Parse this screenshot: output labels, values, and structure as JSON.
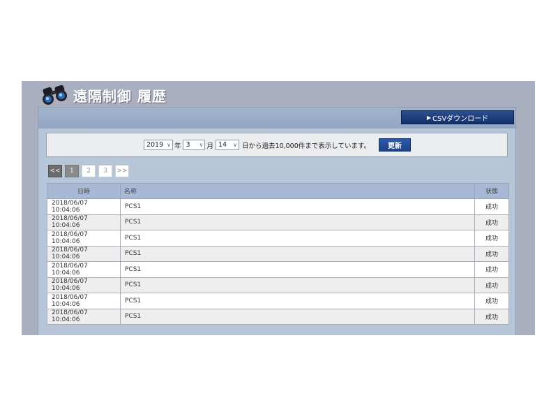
{
  "header": {
    "title": "遠隔制御 履歴"
  },
  "toolbar": {
    "csv_label": "CSVダウンロード"
  },
  "filter": {
    "year": "2019",
    "year_unit": "年",
    "month": "3",
    "month_unit": "月",
    "day": "14",
    "description": "日から過去10,000件まで表示しています。",
    "update_label": "更新"
  },
  "pagination": {
    "prev": "<<",
    "pages": [
      "1",
      "2",
      "3"
    ],
    "next": ">>",
    "current": "1"
  },
  "table": {
    "headers": {
      "date": "日時",
      "name": "名称",
      "status": "状態"
    },
    "rows": [
      {
        "date": "2018/06/07 10:04:06",
        "name": "PCS1",
        "status": "成功"
      },
      {
        "date": "2018/06/07 10:04:06",
        "name": "PCS1",
        "status": "成功"
      },
      {
        "date": "2018/06/07 10:04:06",
        "name": "PCS1",
        "status": "成功"
      },
      {
        "date": "2018/06/07 10:04:06",
        "name": "PCS1",
        "status": "成功"
      },
      {
        "date": "2018/06/07 10:04:06",
        "name": "PCS1",
        "status": "成功"
      },
      {
        "date": "2018/06/07 10:04:06",
        "name": "PCS1",
        "status": "成功"
      },
      {
        "date": "2018/06/07 10:04:06",
        "name": "PCS1",
        "status": "成功"
      },
      {
        "date": "2018/06/07 10:04:06",
        "name": "PCS1",
        "status": "成功"
      }
    ]
  },
  "colors": {
    "app_bg": "#a9afbf",
    "panel_bg": "#b7c5d9",
    "header_bg": "#a7b9d4",
    "accent": "#1d4288"
  }
}
